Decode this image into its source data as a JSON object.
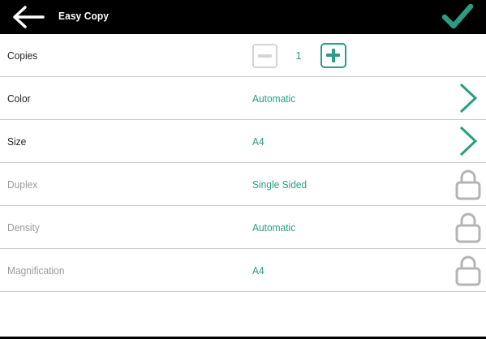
{
  "header": {
    "title": "Easy Copy",
    "back_icon": "arrow-left-icon",
    "confirm_icon": "checkmark-icon"
  },
  "colors": {
    "accent": "#2a9d82",
    "header_bg": "#000000",
    "locked_text": "#9a9a9a",
    "lock_icon": "#b4b4b4",
    "divider": "#c8c8c8"
  },
  "copies": {
    "label": "Copies",
    "value": "1",
    "decrement_icon": "minus-icon",
    "increment_icon": "plus-icon"
  },
  "settings": [
    {
      "label": "Color",
      "value": "Automatic",
      "icon": "chevron-right-icon",
      "locked": false
    },
    {
      "label": "Size",
      "value": "A4",
      "icon": "chevron-right-icon",
      "locked": false
    },
    {
      "label": "Duplex",
      "value": "Single Sided",
      "icon": "lock-icon",
      "locked": true
    },
    {
      "label": "Density",
      "value": "Automatic",
      "icon": "lock-icon",
      "locked": true
    },
    {
      "label": "Magnification",
      "value": "A4",
      "icon": "lock-icon",
      "locked": true
    }
  ]
}
